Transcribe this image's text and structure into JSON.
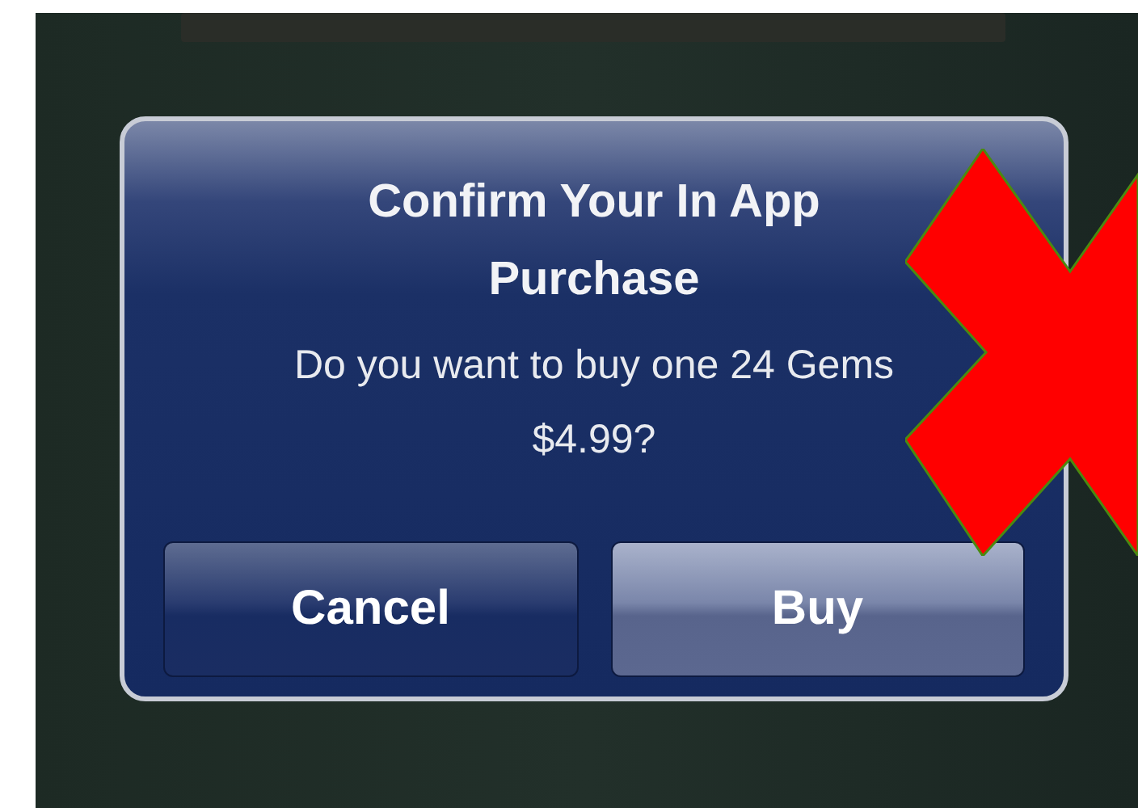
{
  "alert": {
    "title_lines": [
      "Confirm Your In App",
      "Purchase"
    ],
    "message_lines": [
      "Do you want to buy one 24 Gems",
      "$4.99?"
    ],
    "buttons": [
      {
        "label": "Cancel",
        "kind": "cancel"
      },
      {
        "label": "Buy",
        "kind": "default"
      }
    ]
  },
  "overlay": {
    "kind": "cross"
  }
}
